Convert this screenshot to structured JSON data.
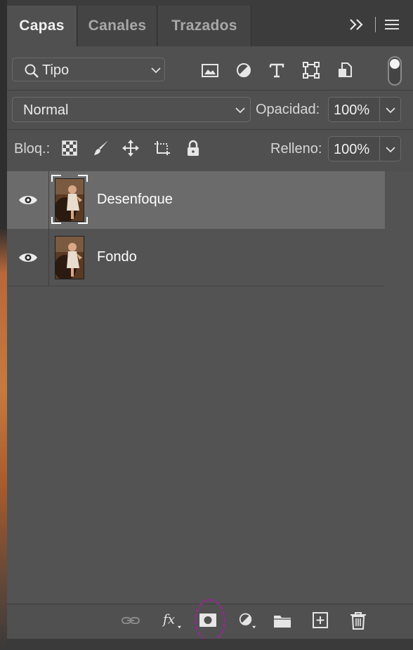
{
  "tabs": [
    {
      "label": "Capas"
    },
    {
      "label": "Canales"
    },
    {
      "label": "Trazados"
    }
  ],
  "filter": {
    "kind_value": "Tipo",
    "kind_icons": [
      "image-filter-icon",
      "adjustment-filter-icon",
      "type-filter-icon",
      "shape-filter-icon",
      "smart-object-filter-icon"
    ],
    "filter_toggle_on": true
  },
  "blend": {
    "mode": "Normal",
    "opacity_label": "Opacidad:",
    "opacity_value": "100%"
  },
  "lock": {
    "label": "Bloq.:",
    "icons": [
      "lock-transparent-pixels-icon",
      "lock-image-pixels-icon",
      "lock-position-icon",
      "lock-artboard-icon",
      "lock-all-icon"
    ],
    "fill_label": "Relleno:",
    "fill_value": "100%"
  },
  "layers": [
    {
      "name": "Desenfoque",
      "visible": true,
      "selected": true
    },
    {
      "name": "Fondo",
      "visible": true,
      "selected": false
    }
  ],
  "bottom_icons": [
    "link-layers-icon",
    "layer-style-fx-icon",
    "add-mask-icon",
    "new-adjustment-layer-icon",
    "new-group-icon",
    "new-layer-icon",
    "delete-layer-icon"
  ],
  "colors": {
    "panel_bg": "#505050",
    "selected_layer": "#6b6b6b",
    "highlight_circle": "#8b2d8b"
  }
}
